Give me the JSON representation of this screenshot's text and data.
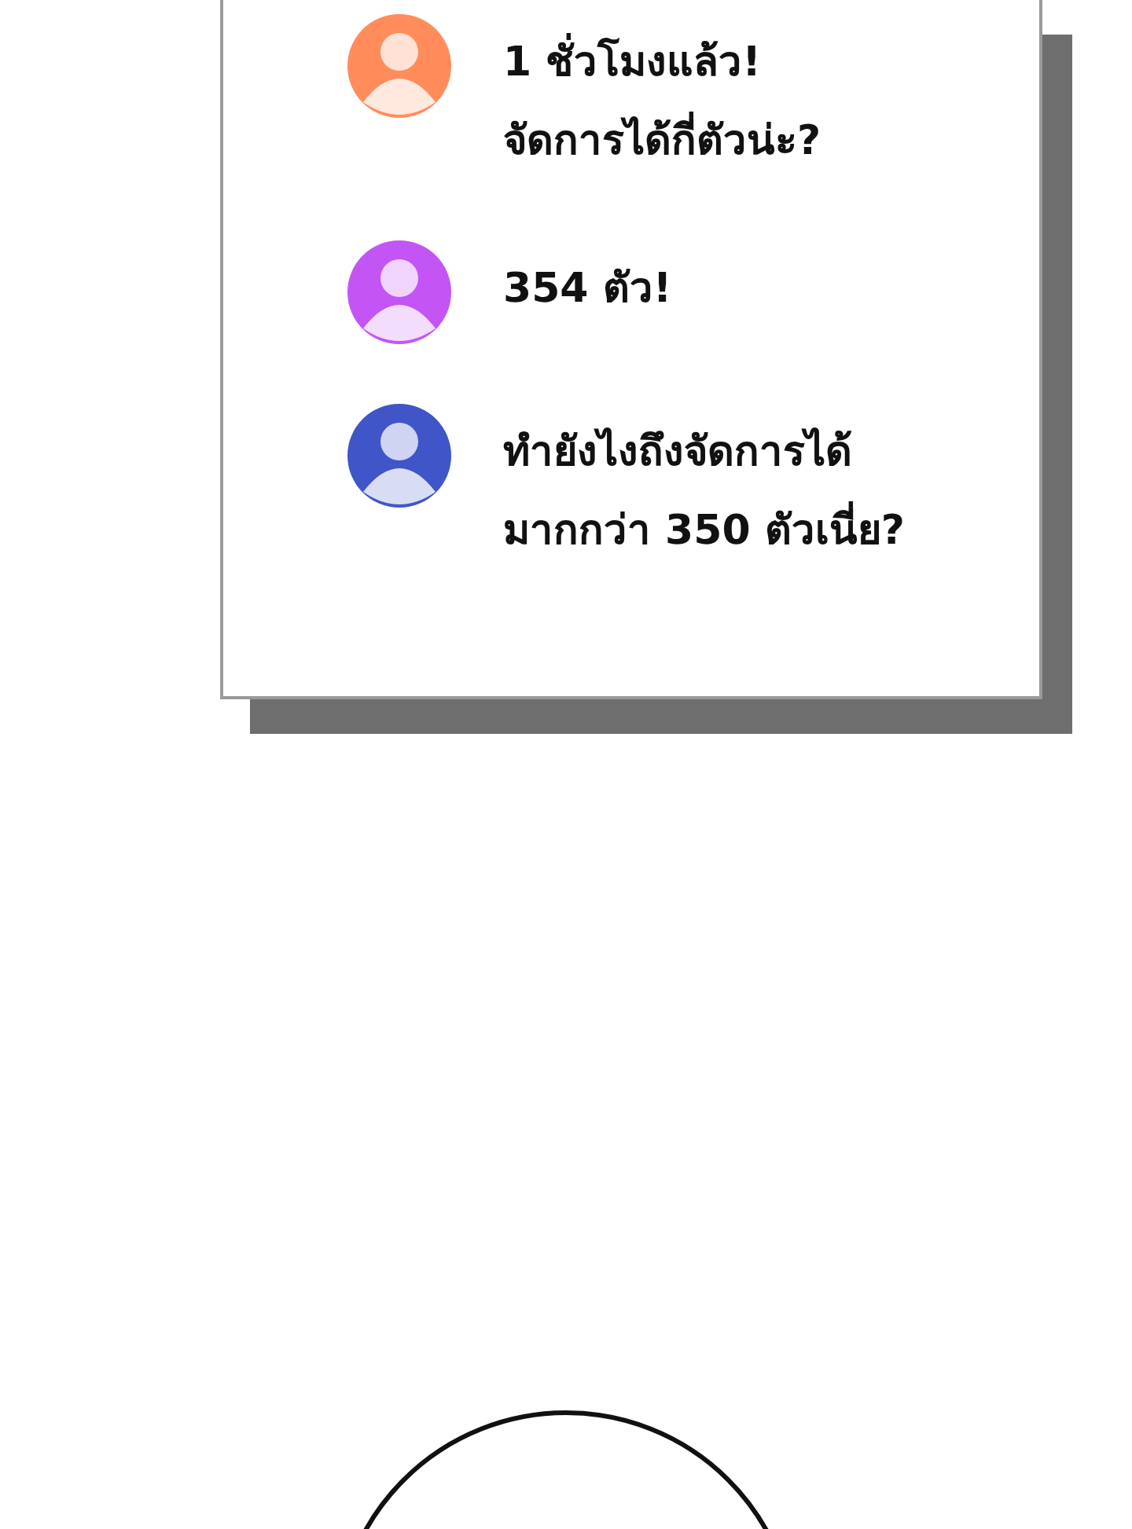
{
  "chat": {
    "messages": [
      {
        "color": "#ff8c5a",
        "text": "1 ชั่วโมงแล้ว!\nจัดการได้กี่ตัวน่ะ?"
      },
      {
        "color": "#c455f5",
        "text": "354 ตัว!"
      },
      {
        "color": "#3f55c8",
        "text": "ทำยังไงถึงจัดการได้\nมากกว่า 350 ตัวเนี่ย?"
      }
    ]
  }
}
